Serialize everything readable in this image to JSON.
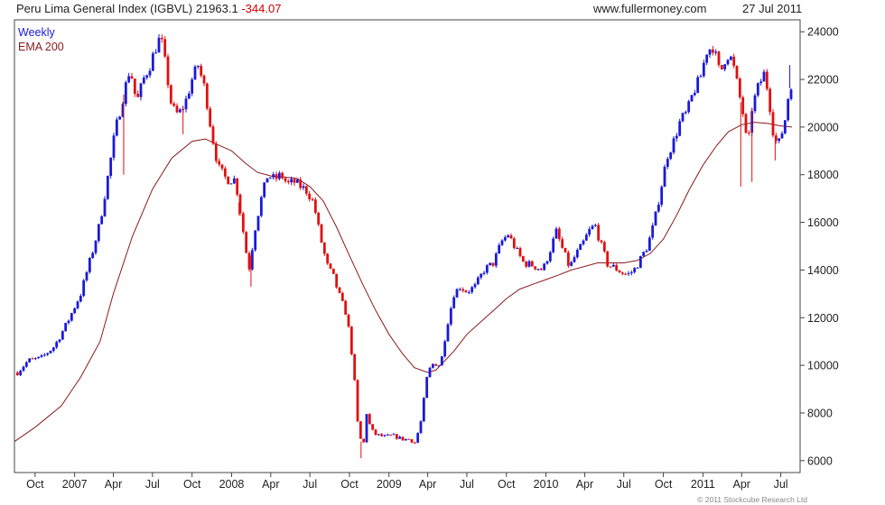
{
  "header": {
    "title": "Peru Lima General Index (IGBVL) 21963.1",
    "change": "-344.07",
    "site": "www.fullermoney.com",
    "date": "27 Jul 2011"
  },
  "copyright": "© 2011 Stockcube Research Ltd",
  "colors": {
    "up": "#1a1ad8",
    "down": "#e01010",
    "ema": "#8b1a1a",
    "change": "#cc0000",
    "frame": "#444444"
  },
  "chart_data": {
    "type": "candlestick",
    "legend": [
      "Weekly",
      "EMA 200"
    ],
    "ylim": [
      5500,
      24500
    ],
    "yticks": [
      6000,
      8000,
      10000,
      12000,
      14000,
      16000,
      18000,
      20000,
      22000,
      24000
    ],
    "ytick_labels": [
      "6000",
      "8000",
      "10000",
      "12000",
      "14000",
      "16000",
      "18000",
      "20000",
      "22000",
      "24000"
    ],
    "xlim": [
      "2006-08-14",
      "2011-08-15"
    ],
    "xticks": [
      {
        "date": "2006-10-01",
        "label": "Oct"
      },
      {
        "date": "2007-01-01",
        "label": "2007"
      },
      {
        "date": "2007-04-01",
        "label": "Apr"
      },
      {
        "date": "2007-07-01",
        "label": "Jul"
      },
      {
        "date": "2007-10-01",
        "label": "Oct"
      },
      {
        "date": "2008-01-01",
        "label": "2008"
      },
      {
        "date": "2008-04-01",
        "label": "Apr"
      },
      {
        "date": "2008-07-01",
        "label": "Jul"
      },
      {
        "date": "2008-10-01",
        "label": "Oct"
      },
      {
        "date": "2009-01-01",
        "label": "2009"
      },
      {
        "date": "2009-04-01",
        "label": "Apr"
      },
      {
        "date": "2009-07-01",
        "label": "Jul"
      },
      {
        "date": "2009-10-01",
        "label": "Oct"
      },
      {
        "date": "2010-01-01",
        "label": "2010"
      },
      {
        "date": "2010-04-01",
        "label": "Apr"
      },
      {
        "date": "2010-07-01",
        "label": "Jul"
      },
      {
        "date": "2010-10-01",
        "label": "Oct"
      },
      {
        "date": "2011-01-01",
        "label": "2011"
      },
      {
        "date": "2011-04-01",
        "label": "Apr"
      },
      {
        "date": "2011-07-01",
        "label": "Jul"
      }
    ],
    "price_path": [
      [
        "2006-08-21",
        9700
      ],
      [
        "2006-09-15",
        10200
      ],
      [
        "2006-10-15",
        10300
      ],
      [
        "2006-11-15",
        10800
      ],
      [
        "2006-12-15",
        11800
      ],
      [
        "2007-01-15",
        13000
      ],
      [
        "2007-02-15",
        15000
      ],
      [
        "2007-03-01",
        16000
      ],
      [
        "2007-03-20",
        18000
      ],
      [
        "2007-04-05",
        19800
      ],
      [
        "2007-04-20",
        21000
      ],
      [
        "2007-05-10",
        22500
      ],
      [
        "2007-05-25",
        21000
      ],
      [
        "2007-06-10",
        22000
      ],
      [
        "2007-06-25",
        22600
      ],
      [
        "2007-07-10",
        23400
      ],
      [
        "2007-07-20",
        23800
      ],
      [
        "2007-08-01",
        22500
      ],
      [
        "2007-08-15",
        20800
      ],
      [
        "2007-08-30",
        20500
      ],
      [
        "2007-09-15",
        21000
      ],
      [
        "2007-10-01",
        22000
      ],
      [
        "2007-10-15",
        22600
      ],
      [
        "2007-11-01",
        21500
      ],
      [
        "2007-11-15",
        19800
      ],
      [
        "2007-12-01",
        18300
      ],
      [
        "2007-12-20",
        17800
      ],
      [
        "2008-01-10",
        17800
      ],
      [
        "2008-01-25",
        16000
      ],
      [
        "2008-02-10",
        14000
      ],
      [
        "2008-02-25",
        15800
      ],
      [
        "2008-03-10",
        17000
      ],
      [
        "2008-03-25",
        18000
      ],
      [
        "2008-04-10",
        17800
      ],
      [
        "2008-04-25",
        18000
      ],
      [
        "2008-05-10",
        17600
      ],
      [
        "2008-05-25",
        17700
      ],
      [
        "2008-06-10",
        17500
      ],
      [
        "2008-06-25",
        17300
      ],
      [
        "2008-07-10",
        16800
      ],
      [
        "2008-07-25",
        15400
      ],
      [
        "2008-08-10",
        14200
      ],
      [
        "2008-08-25",
        13700
      ],
      [
        "2008-09-10",
        12800
      ],
      [
        "2008-09-25",
        12100
      ],
      [
        "2008-10-10",
        10000
      ],
      [
        "2008-10-20",
        7600
      ],
      [
        "2008-11-01",
        6400
      ],
      [
        "2008-11-10",
        8000
      ],
      [
        "2008-11-20",
        7300
      ],
      [
        "2008-12-01",
        7100
      ],
      [
        "2008-12-20",
        7000
      ],
      [
        "2009-01-10",
        7050
      ],
      [
        "2009-02-01",
        6900
      ],
      [
        "2009-02-20",
        6900
      ],
      [
        "2009-03-01",
        6700
      ],
      [
        "2009-03-15",
        7500
      ],
      [
        "2009-04-01",
        9700
      ],
      [
        "2009-04-15",
        10100
      ],
      [
        "2009-05-01",
        10000
      ],
      [
        "2009-05-15",
        11600
      ],
      [
        "2009-06-01",
        13000
      ],
      [
        "2009-06-15",
        13300
      ],
      [
        "2009-07-01",
        13100
      ],
      [
        "2009-07-20",
        13300
      ],
      [
        "2009-08-10",
        14000
      ],
      [
        "2009-09-01",
        14300
      ],
      [
        "2009-09-20",
        15200
      ],
      [
        "2009-10-05",
        15500
      ],
      [
        "2009-10-25",
        14800
      ],
      [
        "2009-11-10",
        14300
      ],
      [
        "2009-12-01",
        14200
      ],
      [
        "2009-12-25",
        14000
      ],
      [
        "2010-01-10",
        14800
      ],
      [
        "2010-01-25",
        15600
      ],
      [
        "2010-02-10",
        14800
      ],
      [
        "2010-02-25",
        14100
      ],
      [
        "2010-03-10",
        14600
      ],
      [
        "2010-03-25",
        15000
      ],
      [
        "2010-04-10",
        15600
      ],
      [
        "2010-04-25",
        15900
      ],
      [
        "2010-05-10",
        15000
      ],
      [
        "2010-05-25",
        14200
      ],
      [
        "2010-06-10",
        14100
      ],
      [
        "2010-06-25",
        13900
      ],
      [
        "2010-07-10",
        13800
      ],
      [
        "2010-07-25",
        14000
      ],
      [
        "2010-08-10",
        14500
      ],
      [
        "2010-08-25",
        15000
      ],
      [
        "2010-09-10",
        16000
      ],
      [
        "2010-09-25",
        17400
      ],
      [
        "2010-10-10",
        18800
      ],
      [
        "2010-10-25",
        19400
      ],
      [
        "2010-11-10",
        20300
      ],
      [
        "2010-11-25",
        20600
      ],
      [
        "2010-12-10",
        21500
      ],
      [
        "2010-12-25",
        22000
      ],
      [
        "2011-01-10",
        23200
      ],
      [
        "2011-01-25",
        23400
      ],
      [
        "2011-02-10",
        22200
      ],
      [
        "2011-02-25",
        23100
      ],
      [
        "2011-03-10",
        22800
      ],
      [
        "2011-03-25",
        21500
      ],
      [
        "2011-04-05",
        20500
      ],
      [
        "2011-04-15",
        19000
      ],
      [
        "2011-04-25",
        20800
      ],
      [
        "2011-05-10",
        21700
      ],
      [
        "2011-05-25",
        22300
      ],
      [
        "2011-06-05",
        21000
      ],
      [
        "2011-06-15",
        19600
      ],
      [
        "2011-06-25",
        19200
      ],
      [
        "2011-07-10",
        20200
      ],
      [
        "2011-07-20",
        21500
      ],
      [
        "2011-07-27",
        21963
      ]
    ],
    "spikes": [
      [
        "2007-04-25",
        18000
      ],
      [
        "2007-09-10",
        19700
      ],
      [
        "2008-01-18",
        16300
      ],
      [
        "2008-02-15",
        13300
      ],
      [
        "2008-10-28",
        6100
      ],
      [
        "2011-03-30",
        17500
      ],
      [
        "2011-04-25",
        17700
      ],
      [
        "2011-06-18",
        18600
      ],
      [
        "2011-07-22",
        22600
      ]
    ],
    "ema_path": [
      [
        "2006-08-14",
        6800
      ],
      [
        "2006-10-01",
        7400
      ],
      [
        "2006-12-01",
        8300
      ],
      [
        "2007-01-15",
        9500
      ],
      [
        "2007-03-01",
        11000
      ],
      [
        "2007-04-01",
        13000
      ],
      [
        "2007-05-15",
        15400
      ],
      [
        "2007-07-01",
        17400
      ],
      [
        "2007-08-15",
        18700
      ],
      [
        "2007-10-01",
        19400
      ],
      [
        "2007-11-01",
        19500
      ],
      [
        "2007-12-01",
        19250
      ],
      [
        "2008-01-01",
        19000
      ],
      [
        "2008-02-01",
        18500
      ],
      [
        "2008-03-01",
        18100
      ],
      [
        "2008-04-01",
        17950
      ],
      [
        "2008-05-01",
        17900
      ],
      [
        "2008-06-01",
        17850
      ],
      [
        "2008-07-01",
        17500
      ],
      [
        "2008-08-01",
        16900
      ],
      [
        "2008-09-01",
        15800
      ],
      [
        "2008-10-01",
        14600
      ],
      [
        "2008-11-01",
        13400
      ],
      [
        "2008-12-01",
        12300
      ],
      [
        "2009-01-01",
        11300
      ],
      [
        "2009-02-01",
        10500
      ],
      [
        "2009-03-01",
        9900
      ],
      [
        "2009-04-01",
        9700
      ],
      [
        "2009-04-20",
        9800
      ],
      [
        "2009-06-01",
        10600
      ],
      [
        "2009-07-01",
        11300
      ],
      [
        "2009-08-01",
        11800
      ],
      [
        "2009-09-01",
        12300
      ],
      [
        "2009-10-01",
        12800
      ],
      [
        "2009-11-01",
        13200
      ],
      [
        "2009-12-01",
        13400
      ],
      [
        "2010-01-01",
        13600
      ],
      [
        "2010-02-01",
        13800
      ],
      [
        "2010-03-01",
        14000
      ],
      [
        "2010-04-01",
        14150
      ],
      [
        "2010-05-01",
        14300
      ],
      [
        "2010-06-01",
        14300
      ],
      [
        "2010-07-01",
        14300
      ],
      [
        "2010-08-01",
        14400
      ],
      [
        "2010-09-01",
        14700
      ],
      [
        "2010-10-01",
        15300
      ],
      [
        "2010-11-01",
        16300
      ],
      [
        "2010-12-01",
        17400
      ],
      [
        "2011-01-01",
        18400
      ],
      [
        "2011-02-01",
        19200
      ],
      [
        "2011-03-01",
        19800
      ],
      [
        "2011-04-01",
        20100
      ],
      [
        "2011-05-01",
        20200
      ],
      [
        "2011-06-01",
        20150
      ],
      [
        "2011-07-01",
        20050
      ],
      [
        "2011-07-27",
        20000
      ]
    ]
  }
}
